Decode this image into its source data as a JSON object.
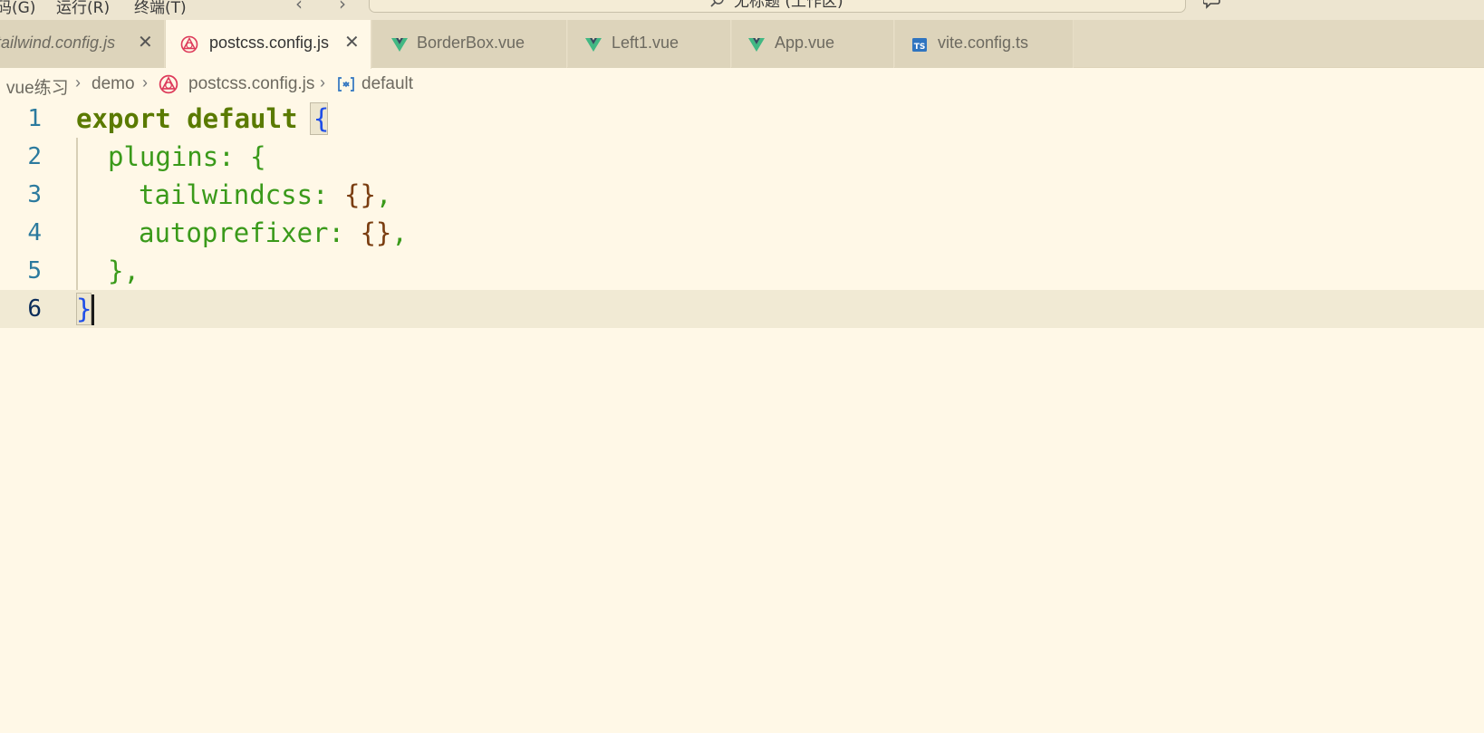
{
  "menu": {
    "items": [
      "码(G)",
      "运行(R)",
      "终端(T)"
    ]
  },
  "command_center": {
    "text": "无标题 (工作区)"
  },
  "tabs": [
    {
      "label": "tailwind.config.js",
      "icon": "tailwind-icon",
      "italic": true,
      "active": false
    },
    {
      "label": "postcss.config.js",
      "icon": "postcss-icon",
      "italic": false,
      "active": true
    },
    {
      "label": "BorderBox.vue",
      "icon": "vue-icon",
      "italic": false,
      "active": false
    },
    {
      "label": "Left1.vue",
      "icon": "vue-icon",
      "italic": false,
      "active": false
    },
    {
      "label": "App.vue",
      "icon": "vue-icon",
      "italic": false,
      "active": false
    },
    {
      "label": "vite.config.ts",
      "icon": "typescript-icon",
      "italic": false,
      "active": false
    }
  ],
  "breadcrumb": {
    "items": [
      "vue练习",
      "demo",
      "postcss.config.js",
      "default"
    ]
  },
  "editor": {
    "line_numbers": [
      "1",
      "2",
      "3",
      "4",
      "5",
      "6"
    ],
    "lines": {
      "l1_kw": "export default",
      "l1_brace": "{",
      "l2_key": "plugins: {",
      "l3_key": "tailwindcss: ",
      "l3_val": "{}",
      "l3_comma": ",",
      "l4_key": "autoprefixer: ",
      "l4_val": "{}",
      "l4_comma": ",",
      "l5": "},",
      "l6_brace": "}"
    },
    "current_line": 6
  },
  "colors": {
    "background": "#fff8e7",
    "keyword": "#5a7a00",
    "property": "#3a9a1a",
    "bracket_outer": "#1f4ee8",
    "bracket_inner": "#7a3d10",
    "line_number": "#2b7a9e",
    "vue_green": "#41b883",
    "postcss_red": "#dd3a5a",
    "ts_blue": "#2f74c0"
  }
}
